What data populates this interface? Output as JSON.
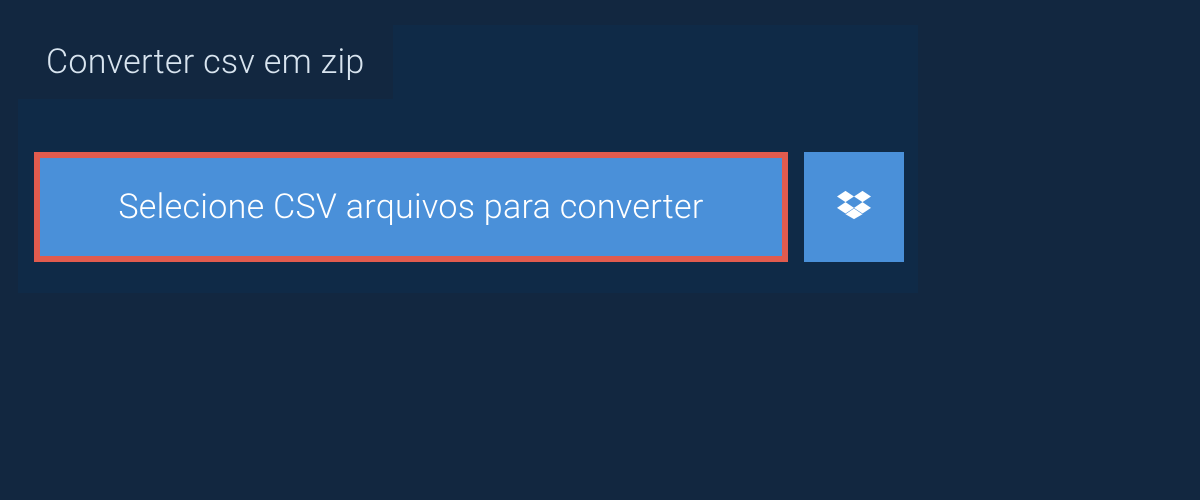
{
  "tab": {
    "label": "Converter csv em zip"
  },
  "buttons": {
    "select_files": "Selecione CSV arquivos para converter"
  }
}
